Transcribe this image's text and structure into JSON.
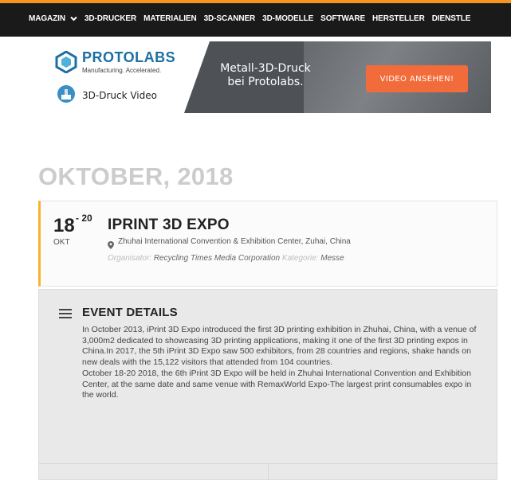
{
  "nav": {
    "items": [
      "MAGAZIN",
      "3D-DRUCKER",
      "MATERIALIEN",
      "3D-SCANNER",
      "3D-MODELLE",
      "SOFTWARE",
      "HERSTELLER",
      "DIENSTLE"
    ]
  },
  "banner": {
    "brand": "PROTOLABS",
    "tagline": "Manufacturing. Accelerated.",
    "video_label": "3D-Druck Video",
    "headline_line1": "Metall-3D-Druck",
    "headline_line2": "bei Protolabs.",
    "cta": "VIDEO ANSEHEN!"
  },
  "archive": {
    "month_heading": "OKTOBER, 2018"
  },
  "event": {
    "day": "18",
    "end_day": "- 20",
    "month": "OKT",
    "title": "IPRINT 3D EXPO",
    "venue": "Zhuhai International Convention & Exhibition Center, Zuhai, China",
    "organizer_label": "Organisator:",
    "organizer": "Recycling Times Media Corporation",
    "category_label": "Kategorie:",
    "category": "Messe"
  },
  "details": {
    "title": "EVENT DETAILS",
    "paragraph1": "In October 2013, iPrint 3D Expo introduced the first 3D printing exhibition in Zhuhai, China, with a venue of 3,000m2 dedicated to showcasing 3D printing applications, making it one of the first 3D printing expos in China.In 2017, the 5th iPrint 3D Expo saw 500 exhibitors, from 28 countries and regions, shake hands on new deals with the 15,122 visitors that attended from 104 countries.",
    "paragraph2": "October 18-20 2018, the 6th iPrint 3D Expo will be held in Zhuhai International Convention and Exhibition Center, at the same date and same venue with RemaxWorld Expo-The largest print consumables expo in the world."
  },
  "colors": {
    "accent": "#f7941d",
    "brand_blue": "#1d6fa3",
    "cta": "#f26b3a",
    "card_border": "#f7b32b"
  }
}
